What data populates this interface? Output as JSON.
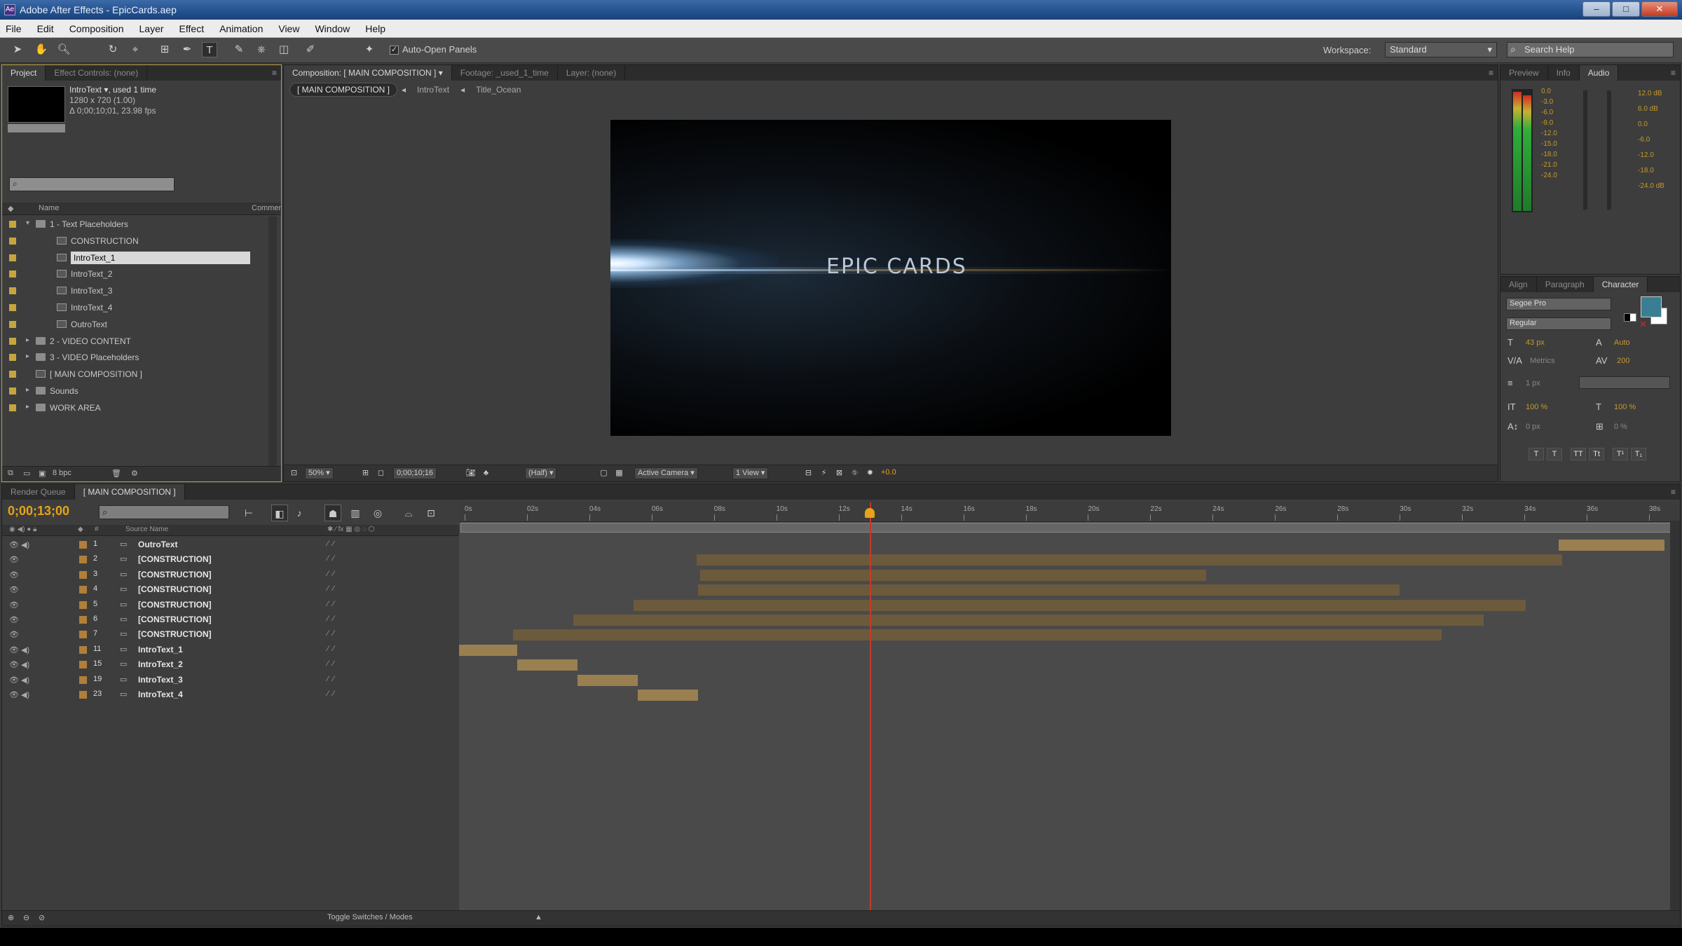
{
  "window": {
    "title": "Adobe After Effects - EpicCards.aep",
    "buttons": {
      "minimize": "–",
      "maximize": "□",
      "close": "✕"
    }
  },
  "menubar": [
    "File",
    "Edit",
    "Composition",
    "Layer",
    "Effect",
    "Animation",
    "View",
    "Window",
    "Help"
  ],
  "toolbar": {
    "auto_open_panels_checked": true,
    "auto_open_label": "Auto-Open Panels",
    "workspace_label": "Workspace:",
    "workspace_value": "Standard",
    "help_search_placeholder": "Search Help"
  },
  "project_panel": {
    "tabs": [
      "Project",
      "Effect Controls: (none)"
    ],
    "selected_item": {
      "name": "IntroText ▾, used 1 time",
      "dims": "1280 x 720 (1.00)",
      "duration": "Δ 0;00;10;01, 23.98 fps"
    },
    "search_value": "",
    "columns": {
      "name": "Name",
      "type": "Comment"
    },
    "items": [
      {
        "name": "1 - Text Placeholders",
        "kind": "folder",
        "indent": 0,
        "twirl": "▾"
      },
      {
        "name": "CONSTRUCTION",
        "kind": "comp",
        "indent": 1,
        "twirl": ""
      },
      {
        "name": "IntroText_1",
        "kind": "comp",
        "indent": 1,
        "twirl": "",
        "selected": true
      },
      {
        "name": "IntroText_2",
        "kind": "comp",
        "indent": 1,
        "twirl": ""
      },
      {
        "name": "IntroText_3",
        "kind": "comp",
        "indent": 1,
        "twirl": ""
      },
      {
        "name": "IntroText_4",
        "kind": "comp",
        "indent": 1,
        "twirl": ""
      },
      {
        "name": "OutroText",
        "kind": "comp",
        "indent": 1,
        "twirl": ""
      },
      {
        "name": "2 - VIDEO CONTENT",
        "kind": "folder",
        "indent": 0,
        "twirl": "▸"
      },
      {
        "name": "3 - VIDEO Placeholders",
        "kind": "folder",
        "indent": 0,
        "twirl": "▸"
      },
      {
        "name": "[ MAIN COMPOSITION ]",
        "kind": "comp",
        "indent": 0,
        "twirl": ""
      },
      {
        "name": "Sounds",
        "kind": "folder",
        "indent": 0,
        "twirl": "▸"
      },
      {
        "name": "WORK AREA",
        "kind": "folder",
        "indent": 0,
        "twirl": "▸"
      }
    ],
    "bpc": "8 bpc"
  },
  "comp_panel": {
    "tabs": [
      "Composition: [ MAIN COMPOSITION ] ▾",
      "Footage: _used_1_time",
      "Layer: (none)"
    ],
    "breadcrumbs": [
      "[ MAIN COMPOSITION ]",
      "IntroText",
      "Title_Ocean"
    ],
    "viewer_text": "EPIC CARDS",
    "bottom": {
      "zoom": "50%",
      "timecode": "0;00;10;16",
      "resolution": "(Half)",
      "view": "Active Camera",
      "views_count": "1 View",
      "offset": "+0.0"
    }
  },
  "audio_panel": {
    "tabs": [
      "Preview",
      "Info",
      "Audio"
    ],
    "left_db": [
      "0.0",
      "-3.0",
      "-6.0",
      "-9.0",
      "-12.0",
      "-15.0",
      "-18.0",
      "-21.0",
      "-24.0"
    ],
    "right_db": [
      "12.0 dB",
      "6.0 dB",
      "0.0",
      "-6.0",
      "-12.0",
      "-18.0",
      "-24.0 dB"
    ]
  },
  "character_panel": {
    "tabs": [
      "Align",
      "Paragraph",
      "Character"
    ],
    "font_family": "Segoe Pro",
    "font_style": "Regular",
    "font_size": "43 px",
    "leading": "Auto",
    "kerning": "Metrics",
    "tracking": "200",
    "stroke_width": "1 px",
    "vert_scale": "100 %",
    "horiz_scale": "100 %",
    "baseline": "0 px",
    "tsume": "0 %",
    "format_buttons": [
      "T",
      "T",
      "TT",
      "Tt",
      "T¹",
      "T₁"
    ]
  },
  "timeline": {
    "tabs": [
      "Render Queue",
      "[ MAIN COMPOSITION ]"
    ],
    "current_time": "0;00;13;00",
    "search_value": "",
    "column_headers": {
      "source_name": "Source Name"
    },
    "ruler_labels": [
      "0s",
      "02s",
      "04s",
      "06s",
      "08s",
      "10s",
      "12s",
      "14s",
      "16s",
      "18s",
      "20s",
      "22s",
      "24s",
      "26s",
      "28s",
      "30s",
      "32s",
      "34s",
      "36s",
      "38s"
    ],
    "playhead_seconds": 13,
    "layers": [
      {
        "num": "1",
        "name": "OutroText",
        "av": "👁 ◀)",
        "bar_start": 0.912,
        "bar_end": 1.0
      },
      {
        "num": "2",
        "name": "[CONSTRUCTION]",
        "av": "👁",
        "bar_start": 0.197,
        "bar_end": 0.915
      },
      {
        "num": "3",
        "name": "[CONSTRUCTION]",
        "av": "👁",
        "bar_start": 0.2,
        "bar_end": 0.62
      },
      {
        "num": "4",
        "name": "[CONSTRUCTION]",
        "av": "👁",
        "bar_start": 0.198,
        "bar_end": 0.78
      },
      {
        "num": "5",
        "name": "[CONSTRUCTION]",
        "av": "👁",
        "bar_start": 0.145,
        "bar_end": 0.885
      },
      {
        "num": "6",
        "name": "[CONSTRUCTION]",
        "av": "👁",
        "bar_start": 0.095,
        "bar_end": 0.85
      },
      {
        "num": "7",
        "name": "[CONSTRUCTION]",
        "av": "👁",
        "bar_start": 0.045,
        "bar_end": 0.815
      },
      {
        "num": "11",
        "name": "IntroText_1",
        "av": "👁 ◀)",
        "bar_start": 0.0,
        "bar_end": 0.048
      },
      {
        "num": "15",
        "name": "IntroText_2",
        "av": "👁 ◀)",
        "bar_start": 0.048,
        "bar_end": 0.098
      },
      {
        "num": "19",
        "name": "IntroText_3",
        "av": "👁 ◀)",
        "bar_start": 0.098,
        "bar_end": 0.148
      },
      {
        "num": "23",
        "name": "IntroText_4",
        "av": "👁 ◀)",
        "bar_start": 0.148,
        "bar_end": 0.198
      }
    ],
    "bottom_label": "Toggle Switches / Modes"
  },
  "colors": {
    "accent_timecode": "#e8a316",
    "playhead": "#c43a2a",
    "label_yellow": "#c7a53d",
    "layer_bar": "#6c5a3c"
  }
}
